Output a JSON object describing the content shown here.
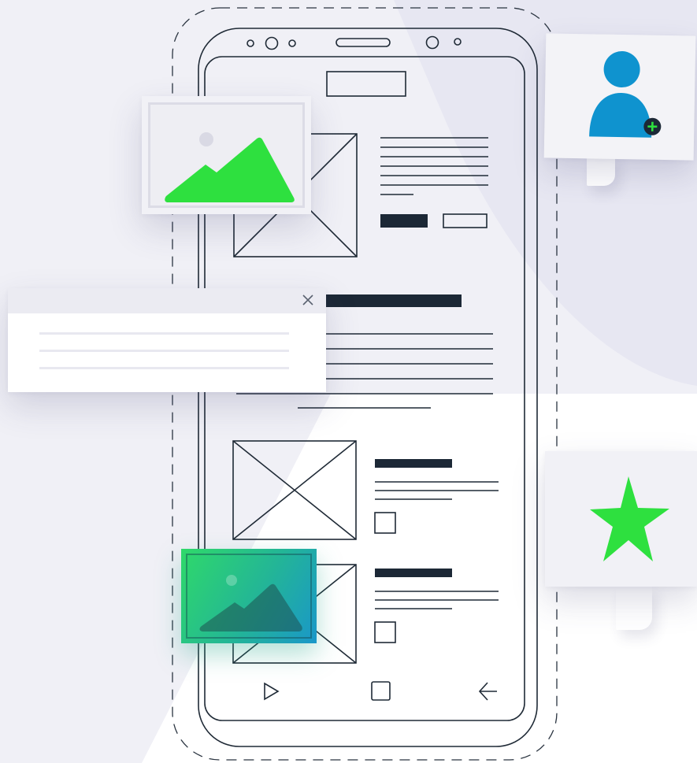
{
  "colors": {
    "background": "#ffffff",
    "bg_shape": "#efeff6",
    "bg_shape_dark": "#e6e6f1",
    "wire_stroke": "#1f2a36",
    "accent_green": "#2ee03f",
    "accent_blue": "#0f93cf",
    "card_bg": "#f1f1f6"
  },
  "icons": {
    "image_card": "mountain-image-icon",
    "gradient_card": "mountain-image-icon",
    "profile": "user-add-icon",
    "star": "star-icon",
    "dialog_close": "close-icon",
    "nav_back": "play-triangle-icon",
    "nav_home": "square-home-icon",
    "nav_recent": "arrow-left-icon"
  }
}
